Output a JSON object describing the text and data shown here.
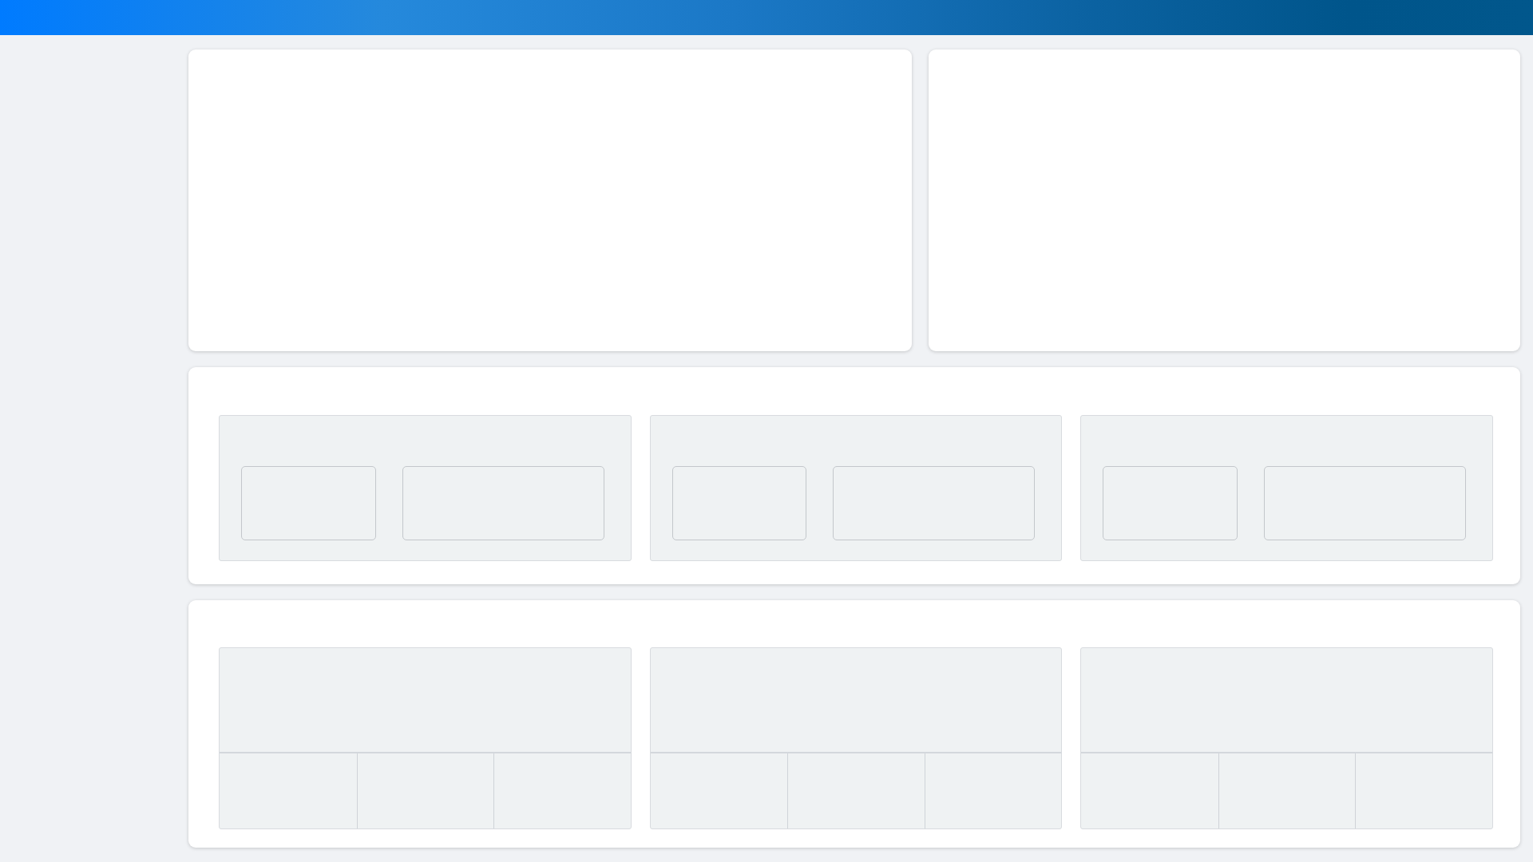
{
  "cards": [
    {
      "kind": "blank"
    },
    {
      "kind": "blank"
    },
    {
      "kind": "box_groups"
    },
    {
      "kind": "cell_grids"
    }
  ]
}
